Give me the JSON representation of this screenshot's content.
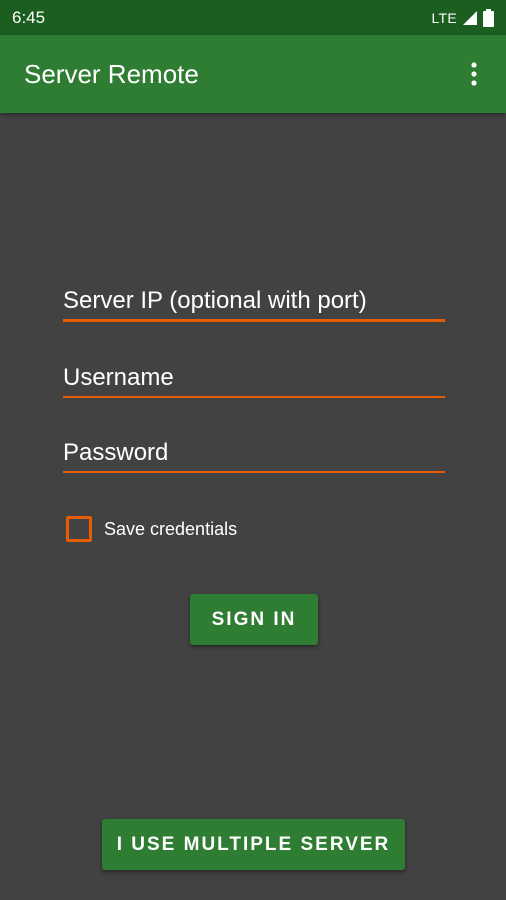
{
  "status_bar": {
    "time": "6:45",
    "network": "LTE",
    "icons": [
      "signal-icon",
      "battery-icon"
    ]
  },
  "app_bar": {
    "title": "Server Remote",
    "overflow_icon": "more-vert-icon"
  },
  "form": {
    "server_ip_placeholder": "Server IP (optional with port)",
    "username_placeholder": "Username",
    "password_placeholder": "Password",
    "save_credentials_label": "Save credentials",
    "save_credentials_checked": false
  },
  "actions": {
    "sign_in_label": "SIGN IN",
    "multiple_server_label": "I USE MULTIPLE SERVER"
  },
  "colors": {
    "status_bar": "#1b5e20",
    "app_bar": "#2e7d32",
    "background": "#424242",
    "accent": "#e65c00",
    "button": "#2e7d32"
  }
}
